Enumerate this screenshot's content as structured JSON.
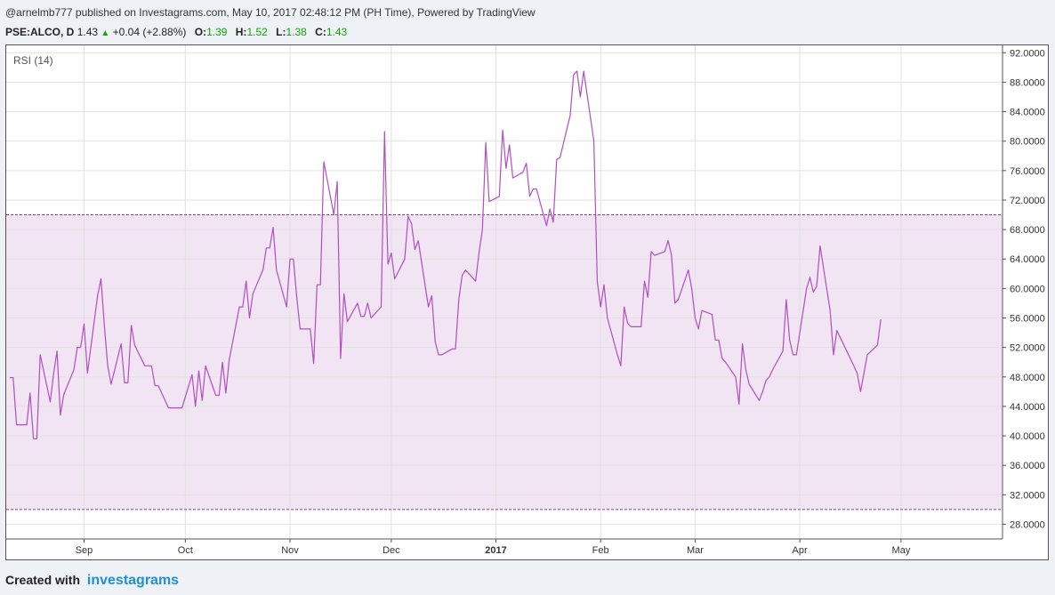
{
  "header": {
    "published_text": "@arnelmb777 published on Investagrams.com, May 10, 2017 02:48:12 PM (PH Time), Powered by TradingView",
    "symbol": "PSE:ALCO, D",
    "last": "1.43",
    "change": "+0.04 (+2.88%)",
    "open_label": "O:",
    "open": "1.39",
    "high_label": "H:",
    "high": "1.52",
    "low_label": "L:",
    "low": "1.38",
    "close_label": "C:",
    "close": "1.43"
  },
  "footer": {
    "created_with": "Created with",
    "brand": "investagrams"
  },
  "colors": {
    "line": "#b04fbf",
    "band_fill": "#f1e4f3",
    "band_border": "#8a3d8f",
    "price_up": "#0ea600",
    "brand": "#1f8fd6"
  },
  "chart_data": {
    "type": "line",
    "title": "RSI (14)",
    "ylim": [
      26.0,
      93.0
    ],
    "y_ticks": [
      "92.0000",
      "88.0000",
      "84.0000",
      "80.0000",
      "76.0000",
      "72.0000",
      "68.0000",
      "64.0000",
      "60.0000",
      "56.0000",
      "52.0000",
      "48.0000",
      "44.0000",
      "40.0000",
      "36.0000",
      "32.0000",
      "28.0000"
    ],
    "x_ticks": [
      "Sep",
      "Oct",
      "Nov",
      "Dec",
      "2017",
      "Feb",
      "Mar",
      "Apr",
      "May"
    ],
    "x_ticks_bold": [
      false,
      false,
      false,
      false,
      true,
      false,
      false,
      false,
      false
    ],
    "x_tick_dates": [
      "2016-09-01",
      "2016-10-01",
      "2016-11-01",
      "2016-12-01",
      "2017-01-01",
      "2017-02-01",
      "2017-03-01",
      "2017-04-01",
      "2017-05-01"
    ],
    "x_range": [
      "2016-08-10",
      "2017-05-30"
    ],
    "bands": [
      {
        "upper": 70,
        "lower": 30
      }
    ],
    "grid": true,
    "series": [
      {
        "values": [
          [
            "2016-08-10",
            47.9
          ],
          [
            "2016-08-11",
            47.9
          ],
          [
            "2016-08-12",
            41.5
          ],
          [
            "2016-08-15",
            41.5
          ],
          [
            "2016-08-16",
            45.8
          ],
          [
            "2016-08-17",
            39.6
          ],
          [
            "2016-08-18",
            39.6
          ],
          [
            "2016-08-19",
            51.0
          ],
          [
            "2016-08-22",
            44.6
          ],
          [
            "2016-08-23",
            48.5
          ],
          [
            "2016-08-24",
            51.5
          ],
          [
            "2016-08-25",
            42.8
          ],
          [
            "2016-08-26",
            45.6
          ],
          [
            "2016-08-29",
            49.0
          ],
          [
            "2016-08-30",
            52.0
          ],
          [
            "2016-08-31",
            52.0
          ],
          [
            "2016-09-01",
            55.2
          ],
          [
            "2016-09-02",
            48.5
          ],
          [
            "2016-09-05",
            59.0
          ],
          [
            "2016-09-06",
            61.3
          ],
          [
            "2016-09-07",
            55.0
          ],
          [
            "2016-09-08",
            49.5
          ],
          [
            "2016-09-09",
            47.0
          ],
          [
            "2016-09-12",
            52.5
          ],
          [
            "2016-09-13",
            47.2
          ],
          [
            "2016-09-14",
            47.2
          ],
          [
            "2016-09-15",
            55.0
          ],
          [
            "2016-09-16",
            52.3
          ],
          [
            "2016-09-19",
            49.5
          ],
          [
            "2016-09-20",
            49.5
          ],
          [
            "2016-09-21",
            49.5
          ],
          [
            "2016-09-22",
            46.8
          ],
          [
            "2016-09-23",
            46.8
          ],
          [
            "2016-09-26",
            43.8
          ],
          [
            "2016-09-27",
            43.8
          ],
          [
            "2016-09-28",
            43.8
          ],
          [
            "2016-09-29",
            43.8
          ],
          [
            "2016-09-30",
            43.8
          ],
          [
            "2016-10-03",
            48.3
          ],
          [
            "2016-10-04",
            44.0
          ],
          [
            "2016-10-05",
            48.8
          ],
          [
            "2016-10-06",
            44.8
          ],
          [
            "2016-10-07",
            49.5
          ],
          [
            "2016-10-10",
            45.5
          ],
          [
            "2016-10-11",
            45.5
          ],
          [
            "2016-10-12",
            50.0
          ],
          [
            "2016-10-13",
            45.8
          ],
          [
            "2016-10-14",
            50.3
          ],
          [
            "2016-10-17",
            57.5
          ],
          [
            "2016-10-18",
            57.5
          ],
          [
            "2016-10-19",
            61.0
          ],
          [
            "2016-10-20",
            56.0
          ],
          [
            "2016-10-21",
            59.3
          ],
          [
            "2016-10-24",
            62.5
          ],
          [
            "2016-10-25",
            65.5
          ],
          [
            "2016-10-26",
            65.5
          ],
          [
            "2016-10-27",
            68.3
          ],
          [
            "2016-10-28",
            62.5
          ],
          [
            "2016-10-31",
            57.5
          ],
          [
            "2016-11-01",
            64.0
          ],
          [
            "2016-11-02",
            64.0
          ],
          [
            "2016-11-03",
            58.8
          ],
          [
            "2016-11-04",
            54.5
          ],
          [
            "2016-11-07",
            54.5
          ],
          [
            "2016-11-08",
            49.8
          ],
          [
            "2016-11-09",
            60.5
          ],
          [
            "2016-11-10",
            60.5
          ],
          [
            "2016-11-11",
            77.2
          ],
          [
            "2016-11-14",
            70.0
          ],
          [
            "2016-11-15",
            74.5
          ],
          [
            "2016-11-16",
            50.5
          ],
          [
            "2016-11-17",
            59.3
          ],
          [
            "2016-11-18",
            55.5
          ],
          [
            "2016-11-21",
            58.0
          ],
          [
            "2016-11-22",
            56.2
          ],
          [
            "2016-11-23",
            56.2
          ],
          [
            "2016-11-24",
            58.0
          ],
          [
            "2016-11-25",
            56.0
          ],
          [
            "2016-11-28",
            57.5
          ],
          [
            "2016-11-29",
            81.3
          ],
          [
            "2016-11-30",
            63.3
          ],
          [
            "2016-12-01",
            64.8
          ],
          [
            "2016-12-02",
            61.3
          ],
          [
            "2016-12-05",
            64.0
          ],
          [
            "2016-12-06",
            69.8
          ],
          [
            "2016-12-07",
            68.8
          ],
          [
            "2016-12-08",
            65.3
          ],
          [
            "2016-12-09",
            66.5
          ],
          [
            "2016-12-12",
            57.5
          ],
          [
            "2016-12-13",
            59.0
          ],
          [
            "2016-12-14",
            52.8
          ],
          [
            "2016-12-15",
            51.0
          ],
          [
            "2016-12-16",
            51.0
          ],
          [
            "2016-12-19",
            51.8
          ],
          [
            "2016-12-20",
            51.8
          ],
          [
            "2016-12-21",
            58.5
          ],
          [
            "2016-12-22",
            61.8
          ],
          [
            "2016-12-23",
            62.5
          ],
          [
            "2016-12-26",
            61.0
          ],
          [
            "2016-12-27",
            64.8
          ],
          [
            "2016-12-28",
            68.0
          ],
          [
            "2016-12-29",
            79.8
          ],
          [
            "2016-12-30",
            71.8
          ],
          [
            "2017-01-02",
            72.5
          ],
          [
            "2017-01-03",
            81.5
          ],
          [
            "2017-01-04",
            76.3
          ],
          [
            "2017-01-05",
            79.5
          ],
          [
            "2017-01-06",
            75.0
          ],
          [
            "2017-01-09",
            75.8
          ],
          [
            "2017-01-10",
            77.0
          ],
          [
            "2017-01-11",
            72.5
          ],
          [
            "2017-01-12",
            73.5
          ],
          [
            "2017-01-13",
            73.5
          ],
          [
            "2017-01-16",
            68.5
          ],
          [
            "2017-01-17",
            70.8
          ],
          [
            "2017-01-18",
            69.0
          ],
          [
            "2017-01-19",
            77.5
          ],
          [
            "2017-01-20",
            77.8
          ],
          [
            "2017-01-23",
            83.5
          ],
          [
            "2017-01-24",
            89.0
          ],
          [
            "2017-01-25",
            89.5
          ],
          [
            "2017-01-26",
            86.0
          ],
          [
            "2017-01-27",
            89.5
          ],
          [
            "2017-01-30",
            80.0
          ],
          [
            "2017-01-31",
            61.0
          ],
          [
            "2017-02-01",
            57.5
          ],
          [
            "2017-02-02",
            60.5
          ],
          [
            "2017-02-03",
            56.0
          ],
          [
            "2017-02-06",
            51.0
          ],
          [
            "2017-02-07",
            49.5
          ],
          [
            "2017-02-08",
            57.5
          ],
          [
            "2017-02-09",
            55.3
          ],
          [
            "2017-02-10",
            54.8
          ],
          [
            "2017-02-13",
            54.8
          ],
          [
            "2017-02-14",
            61.0
          ],
          [
            "2017-02-15",
            58.8
          ],
          [
            "2017-02-16",
            65.0
          ],
          [
            "2017-02-17",
            64.5
          ],
          [
            "2017-02-20",
            65.0
          ],
          [
            "2017-02-21",
            66.5
          ],
          [
            "2017-02-22",
            64.5
          ],
          [
            "2017-02-23",
            58.0
          ],
          [
            "2017-02-24",
            58.5
          ],
          [
            "2017-02-27",
            62.5
          ],
          [
            "2017-02-28",
            60.0
          ],
          [
            "2017-03-01",
            56.0
          ],
          [
            "2017-03-02",
            54.5
          ],
          [
            "2017-03-03",
            57.0
          ],
          [
            "2017-03-06",
            56.5
          ],
          [
            "2017-03-07",
            53.0
          ],
          [
            "2017-03-08",
            53.0
          ],
          [
            "2017-03-09",
            50.5
          ],
          [
            "2017-03-10",
            50.0
          ],
          [
            "2017-03-13",
            48.0
          ],
          [
            "2017-03-14",
            44.3
          ],
          [
            "2017-03-15",
            52.5
          ],
          [
            "2017-03-16",
            49.0
          ],
          [
            "2017-03-17",
            47.0
          ],
          [
            "2017-03-20",
            44.8
          ],
          [
            "2017-03-21",
            46.0
          ],
          [
            "2017-03-22",
            47.5
          ],
          [
            "2017-03-23",
            48.0
          ],
          [
            "2017-03-24",
            49.0
          ],
          [
            "2017-03-27",
            51.5
          ],
          [
            "2017-03-28",
            58.5
          ],
          [
            "2017-03-29",
            53.0
          ],
          [
            "2017-03-30",
            51.0
          ],
          [
            "2017-03-31",
            51.0
          ],
          [
            "2017-04-03",
            60.0
          ],
          [
            "2017-04-04",
            61.5
          ],
          [
            "2017-04-05",
            59.5
          ],
          [
            "2017-04-06",
            60.3
          ],
          [
            "2017-04-07",
            65.8
          ],
          [
            "2017-04-10",
            57.0
          ],
          [
            "2017-04-11",
            51.0
          ],
          [
            "2017-04-12",
            54.3
          ],
          [
            "2017-04-17",
            49.5
          ],
          [
            "2017-04-18",
            48.5
          ],
          [
            "2017-04-19",
            46.0
          ],
          [
            "2017-04-20",
            48.5
          ],
          [
            "2017-04-21",
            51.0
          ],
          [
            "2017-04-24",
            52.3
          ],
          [
            "2017-04-25",
            55.8
          ]
        ]
      }
    ]
  }
}
